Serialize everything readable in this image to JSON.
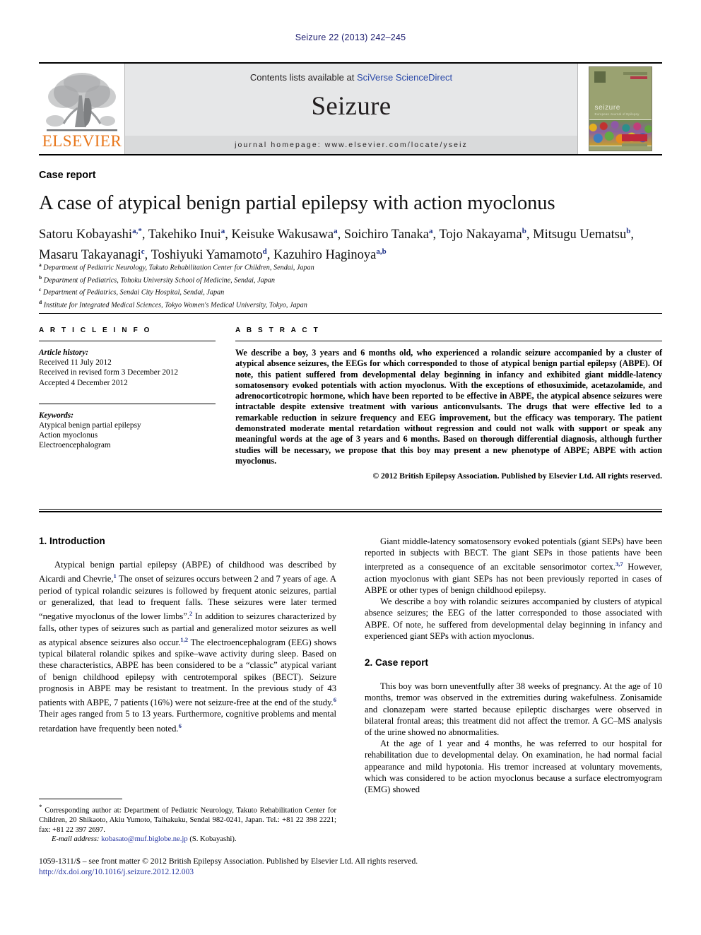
{
  "running_head": "Seizure 22 (2013) 242–245",
  "masthead": {
    "publisher_logo_text": "ELSEVIER",
    "contents_prefix": "Contents lists available at ",
    "contents_link": "SciVerse ScienceDirect",
    "journal_name": "Seizure",
    "homepage": "journal homepage: www.elsevier.com/locate/yseiz",
    "cover": {
      "title": "seizure",
      "subtitle": "European Journal of Epilepsy"
    }
  },
  "article": {
    "kicker": "Case report",
    "title": "A case of atypical benign partial epilepsy with action myoclonus",
    "authors": [
      {
        "name": "Satoru Kobayashi",
        "sup": "a,*"
      },
      {
        "name": "Takehiko Inui",
        "sup": "a"
      },
      {
        "name": "Keisuke Wakusawa",
        "sup": "a"
      },
      {
        "name": "Soichiro Tanaka",
        "sup": "a"
      },
      {
        "name": "Tojo Nakayama",
        "sup": "b"
      },
      {
        "name": "Mitsugu Uematsu",
        "sup": "b"
      },
      {
        "name": "Masaru Takayanagi",
        "sup": "c"
      },
      {
        "name": "Toshiyuki Yamamoto",
        "sup": "d"
      },
      {
        "name": "Kazuhiro Haginoya",
        "sup": "a,b"
      }
    ],
    "affiliations": [
      {
        "mark": "a",
        "text": "Department of Pediatric Neurology, Takuto Rehabilitation Center for Children, Sendai, Japan"
      },
      {
        "mark": "b",
        "text": "Department of Pediatrics, Tohoku University School of Medicine, Sendai, Japan"
      },
      {
        "mark": "c",
        "text": "Department of Pediatrics, Sendai City Hospital, Sendai, Japan"
      },
      {
        "mark": "d",
        "text": "Institute for Integrated Medical Sciences, Tokyo Women's Medical University, Tokyo, Japan"
      }
    ]
  },
  "article_info": {
    "heading": "A R T I C L E  I N F O",
    "history_label": "Article history:",
    "history": [
      "Received 11 July 2012",
      "Received in revised form 3 December 2012",
      "Accepted 4 December 2012"
    ],
    "keywords_label": "Keywords:",
    "keywords": [
      "Atypical benign partial epilepsy",
      "Action myoclonus",
      "Electroencephalogram"
    ]
  },
  "abstract": {
    "heading": "A B S T R A C T",
    "text": "We describe a boy, 3 years and 6 months old, who experienced a rolandic seizure accompanied by a cluster of atypical absence seizures, the EEGs for which corresponded to those of atypical benign partial epilepsy (ABPE). Of note, this patient suffered from developmental delay beginning in infancy and exhibited giant middle-latency somatosensory evoked potentials with action myoclonus. With the exceptions of ethosuximide, acetazolamide, and adrenocorticotropic hormone, which have been reported to be effective in ABPE, the atypical absence seizures were intractable despite extensive treatment with various anticonvulsants. The drugs that were effective led to a remarkable reduction in seizure frequency and EEG improvement, but the efficacy was temporary. The patient demonstrated moderate mental retardation without regression and could not walk with support or speak any meaningful words at the age of 3 years and 6 months. Based on thorough differential diagnosis, although further studies will be necessary, we propose that this boy may present a new phenotype of ABPE; ABPE with action myoclonus.",
    "copyright": "© 2012 British Epilepsy Association. Published by Elsevier Ltd. All rights reserved."
  },
  "body": {
    "left": {
      "section1_heading": "1. Introduction",
      "p1_a": "Atypical benign partial epilepsy (ABPE) of childhood was described by Aicardi and Chevrie,",
      "p1_ref1": "1",
      "p1_b": " The onset of seizures occurs between 2 and 7 years of age. A period of typical rolandic seizures is followed by frequent atonic seizures, partial or generalized, that lead to frequent falls. These seizures were later termed “negative myoclonus of the lower limbs”.",
      "p1_ref2": "2",
      "p1_c": " In addition to seizures characterized by falls, other types of seizures such as partial and generalized motor seizures as well as atypical absence seizures also occur.",
      "p1_ref3": "1,2",
      "p1_d": " The electroencephalogram (EEG) shows typical bilateral rolandic spikes and spike–wave activity during sleep. Based on these characteristics, ABPE has been considered to be a “classic” atypical variant of benign childhood epilepsy with centrotemporal spikes (BECT). Seizure prognosis in ABPE may be resistant to treatment. In the previous study of 43 patients with ABPE, 7 patients (16%) were not seizure-free at the end of the study.",
      "p1_ref4": "6",
      "p1_e": " Their ages ranged from 5 to 13 years. Furthermore, cognitive problems and mental retardation have frequently been noted.",
      "p1_ref5": "6"
    },
    "right": {
      "p1_a": "Giant middle-latency somatosensory evoked potentials (giant SEPs) have been reported in subjects with BECT. The giant SEPs in those patients have been interpreted as a consequence of an excitable sensorimotor cortex.",
      "p1_ref1": "3,7",
      "p1_b": " However, action myoclonus with giant SEPs has not been previously reported in cases of ABPE or other types of benign childhood epilepsy.",
      "p2": "We describe a boy with rolandic seizures accompanied by clusters of atypical absence seizures; the EEG of the latter corresponded to those associated with ABPE. Of note, he suffered from developmental delay beginning in infancy and experienced giant SEPs with action myoclonus.",
      "section2_heading": "2. Case report",
      "p3": "This boy was born uneventfully after 38 weeks of pregnancy. At the age of 10 months, tremor was observed in the extremities during wakefulness. Zonisamide and clonazepam were started because epileptic discharges were observed in bilateral frontal areas; this treatment did not affect the tremor. A GC–MS analysis of the urine showed no abnormalities.",
      "p4": "At the age of 1 year and 4 months, he was referred to our hospital for rehabilitation due to developmental delay. On examination, he had normal facial appearance and mild hypotonia. His tremor increased at voluntary movements, which was considered to be action myoclonus because a surface electromyogram (EMG) showed"
    }
  },
  "footnote": {
    "corresponding": "Corresponding author at: Department of Pediatric Neurology, Takuto Rehabilitation Center for Children, 20 Shikaoto, Akiu Yumoto, Taihakuku, Sendai 982-0241, Japan. Tel.: +81 22 398 2221; fax: +81 22 397 2697.",
    "email_label": "E-mail address:",
    "email": "kobasato@muf.biglobe.ne.jp",
    "email_owner": "(S. Kobayashi)."
  },
  "footer": {
    "issn_line": "1059-1311/$ – see front matter © 2012 British Epilepsy Association. Published by Elsevier Ltd. All rights reserved.",
    "doi": "http://dx.doi.org/10.1016/j.seizure.2012.12.003"
  }
}
